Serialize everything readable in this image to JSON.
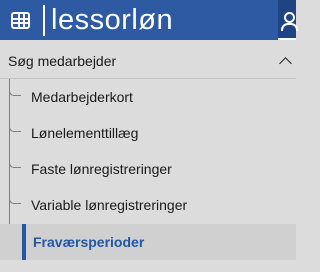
{
  "header": {
    "logo_text": "lessorløn",
    "brand_color": "#2d5aa3",
    "apps_icon": "grid-icon",
    "user_icon": "user-icon"
  },
  "menu": {
    "section_title": "Søg medarbejder",
    "section_state": "expanded",
    "items": [
      {
        "label": "Medarbejderkort",
        "active": false
      },
      {
        "label": "Lønelementtillæg",
        "active": false
      },
      {
        "label": "Faste lønregistreringer",
        "active": false
      },
      {
        "label": "Variable lønregistreringer",
        "active": false
      },
      {
        "label": "Fraværsperioder",
        "active": true
      }
    ],
    "active_color": "#2456a4"
  }
}
